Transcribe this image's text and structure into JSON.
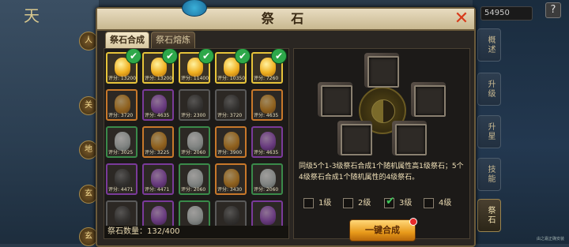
{
  "background": {
    "title": "天",
    "side_icons": [
      "人",
      "关",
      "地",
      "玄",
      "玄"
    ],
    "currency": "54950",
    "help": "?",
    "side_tabs": [
      "概述",
      "升级",
      "升星",
      "技能",
      "祭石"
    ],
    "watermark": "由之霜正确安装"
  },
  "dialog": {
    "title": "祭 石",
    "close": "✕",
    "tabs": [
      "祭石合成",
      "祭石熔炼"
    ],
    "count_label": "祭石数量：132/400",
    "grid": [
      [
        "yellow",
        "yellow",
        "yellow",
        "yellow",
        "yellow"
      ],
      [
        "orange",
        "purple",
        "dark",
        "dark",
        "orange"
      ],
      [
        "white",
        "orange",
        "white",
        "orange",
        "purple"
      ],
      [
        "dark",
        "purple",
        "white",
        "orange",
        "white"
      ],
      [
        "dark",
        "purple",
        "white",
        "dark",
        "purple"
      ]
    ],
    "grid_borders": [
      [
        "gold",
        "gold",
        "gold",
        "gold",
        "gold"
      ],
      [
        "orange",
        "purple",
        "grey",
        "grey",
        "orange"
      ],
      [
        "green",
        "orange",
        "green",
        "orange",
        "purple"
      ],
      [
        "purple",
        "purple",
        "green",
        "orange",
        "green"
      ],
      [
        "grey",
        "purple",
        "green",
        "grey",
        "purple"
      ]
    ],
    "scores": [
      [
        "评分: 13200",
        "评分: 13200",
        "评分: 11400",
        "评分: 10350",
        "评分: 7260"
      ],
      [
        "评分: 3720",
        "评分: 4635",
        "评分: 2300",
        "评分: 3720",
        "评分: 4635"
      ],
      [
        "评分: 3025",
        "评分: 3225",
        "评分: 2060",
        "评分: 3900",
        "评分: 4635"
      ],
      [
        "评分: 4471",
        "评分: 4471",
        "评分: 2060",
        "评分: 3430",
        "评分: 2060"
      ],
      [
        "",
        "",
        "",
        "",
        ""
      ]
    ],
    "checked_first_row": true,
    "description": "同级5个1-3级祭石合成1个随机属性高1级祭石；5个4级祭石合成1个随机属性的4级祭石。",
    "levels": [
      {
        "label": "1级",
        "checked": false
      },
      {
        "label": "2级",
        "checked": false
      },
      {
        "label": "3级",
        "checked": true
      },
      {
        "label": "4级",
        "checked": false
      }
    ],
    "merge_button": "一键合成"
  }
}
